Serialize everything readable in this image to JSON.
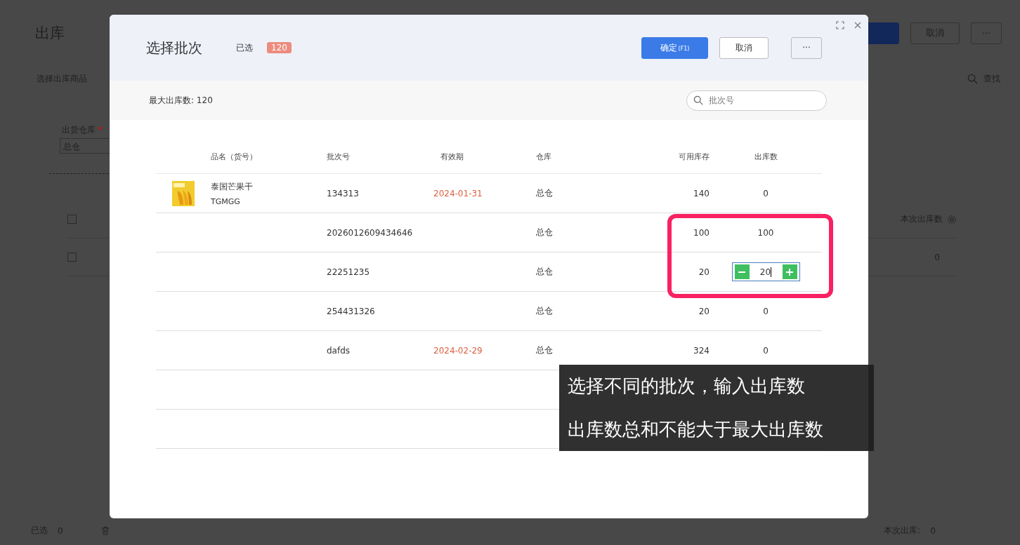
{
  "page": {
    "title": "出库",
    "cancel_button": "取消",
    "more_button": "···",
    "section_title": "选择出库商品",
    "find_link": "查找",
    "warehouse_label": "出货仓库",
    "required_mark": "*",
    "warehouse_value": "总仓",
    "column_header": "本次出库数",
    "row_values": [
      {
        "checked": false
      },
      {
        "checked": false,
        "value": "0"
      }
    ],
    "footer": {
      "selected_label": "已选",
      "selected_count": "0",
      "total_label": "本次出库:",
      "total_value": "0"
    }
  },
  "dialog": {
    "title": "选择批次",
    "selected_label": "已选",
    "selected_badge": "120",
    "confirm_button": "确定",
    "confirm_shortcut": "(F1)",
    "cancel_button": "取消",
    "more_button": "···",
    "max_label": "最大出库数:",
    "max_value": "120",
    "search": {
      "placeholder": "批次号"
    },
    "columns": [
      "品名（货号）",
      "批次号",
      "有效期",
      "仓库",
      "可用库存",
      "出库数"
    ],
    "rows": [
      {
        "product": {
          "name": "泰国芒果干",
          "code": "TGMGG"
        },
        "batch": "134313",
        "expiry": "2024-01-31",
        "warehouse": "总仓",
        "stock": "140",
        "kind": "text",
        "quantity": "0"
      },
      {
        "batch": "2026012609434646",
        "warehouse": "总仓",
        "stock": "100",
        "kind": "text",
        "quantity": "100"
      },
      {
        "batch": "22251235",
        "warehouse": "总仓",
        "stock": "20",
        "kind": "stepper",
        "quantity": "20"
      },
      {
        "batch": "254431326",
        "warehouse": "总仓",
        "stock": "20",
        "kind": "text",
        "quantity": "0"
      },
      {
        "batch": "dafds",
        "expiry": "2024-02-29",
        "warehouse": "总仓",
        "stock": "324",
        "kind": "text",
        "quantity": "0"
      }
    ]
  },
  "caption": [
    "选择不同的批次，输入出库数",
    "出库数总和不能大于最大出库数"
  ]
}
